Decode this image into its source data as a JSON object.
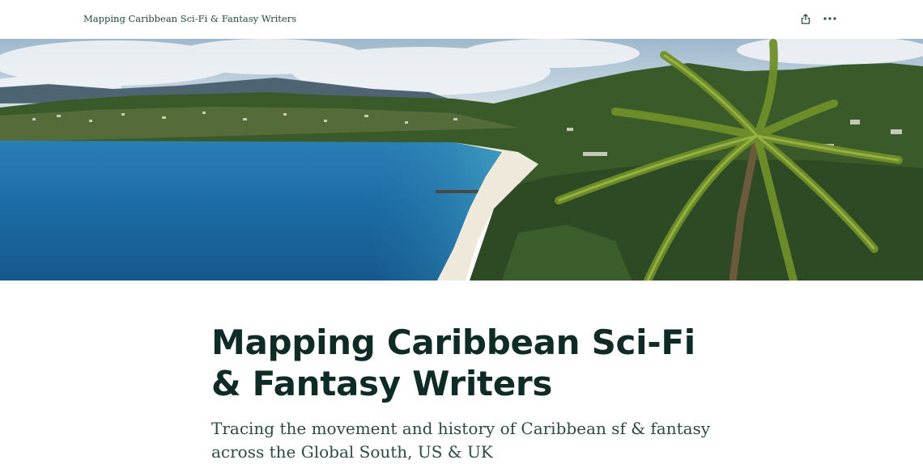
{
  "header": {
    "site_title": "Mapping Caribbean Sci-Fi & Fantasy Writers",
    "share_icon": "share-icon",
    "more_icon": "more-options-icon"
  },
  "hero": {
    "image": "Caribbean bay with turquoise sea, white sand beach, green hills and a palm tree in the foreground"
  },
  "main": {
    "title": "Mapping Caribbean Sci-Fi & Fantasy Writers",
    "subtitle": "Tracing the movement and history of Caribbean sf & fantasy across the Global South, US & UK"
  },
  "colors": {
    "title": "#0f2b27",
    "subtitle": "#2c4a44",
    "header_text": "#1e4a40",
    "sea": "#1e6fa8",
    "hills": "#3b5a2a"
  }
}
